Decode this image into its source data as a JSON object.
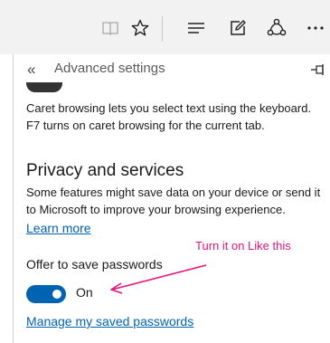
{
  "toolbar": {
    "icons": [
      {
        "name": "reading-view-icon",
        "glyph": "book"
      },
      {
        "name": "favorite-star-icon",
        "glyph": "star"
      },
      {
        "name": "hub-icon",
        "glyph": "lines"
      },
      {
        "name": "web-note-icon",
        "glyph": "pen-square"
      },
      {
        "name": "share-icon",
        "glyph": "share"
      },
      {
        "name": "more-icon",
        "glyph": "dots"
      }
    ]
  },
  "pane": {
    "back_glyph": "«",
    "title": "Advanced settings"
  },
  "caret": {
    "line1": "Caret browsing lets you select text using the keyboard.",
    "line2": "F7 turns on caret browsing for the current tab."
  },
  "privacy": {
    "title": "Privacy and services",
    "desc_line1": "Some features might save data on your device or send it",
    "desc_line2": "to Microsoft to improve your browsing experience.",
    "learn_more": "Learn more"
  },
  "passwords": {
    "label": "Offer to save passwords",
    "toggle_state": "On",
    "toggle_on": true,
    "manage_link": "Manage my saved passwords"
  },
  "annotation": {
    "text": "Turn it on Like this",
    "color": "#e0157c"
  },
  "colors": {
    "accent": "#0063b1",
    "toolbar_bg": "#f2f2f2"
  }
}
